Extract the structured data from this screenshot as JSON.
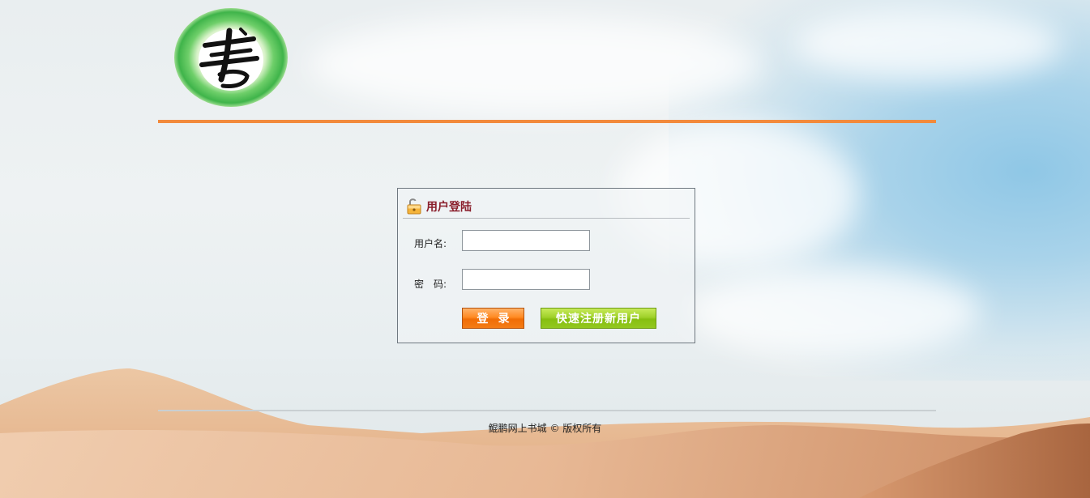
{
  "login": {
    "title": "用户登陆",
    "username_label": "用户名:",
    "username_value": "",
    "password_label": "密　码:",
    "password_value": "",
    "login_button": "登录",
    "register_button": "快速注册新用户"
  },
  "footer": {
    "copyright": "鲲鹏网上书城 © 版权所有"
  },
  "colors": {
    "header_line": "#f28a3c",
    "title_text": "#8a1f2c",
    "login_button": "#f47c14",
    "register_button": "#93c81e"
  },
  "icons": {
    "logo": "calligraphy-seal-logo",
    "title": "unlocked-padlock-icon"
  }
}
